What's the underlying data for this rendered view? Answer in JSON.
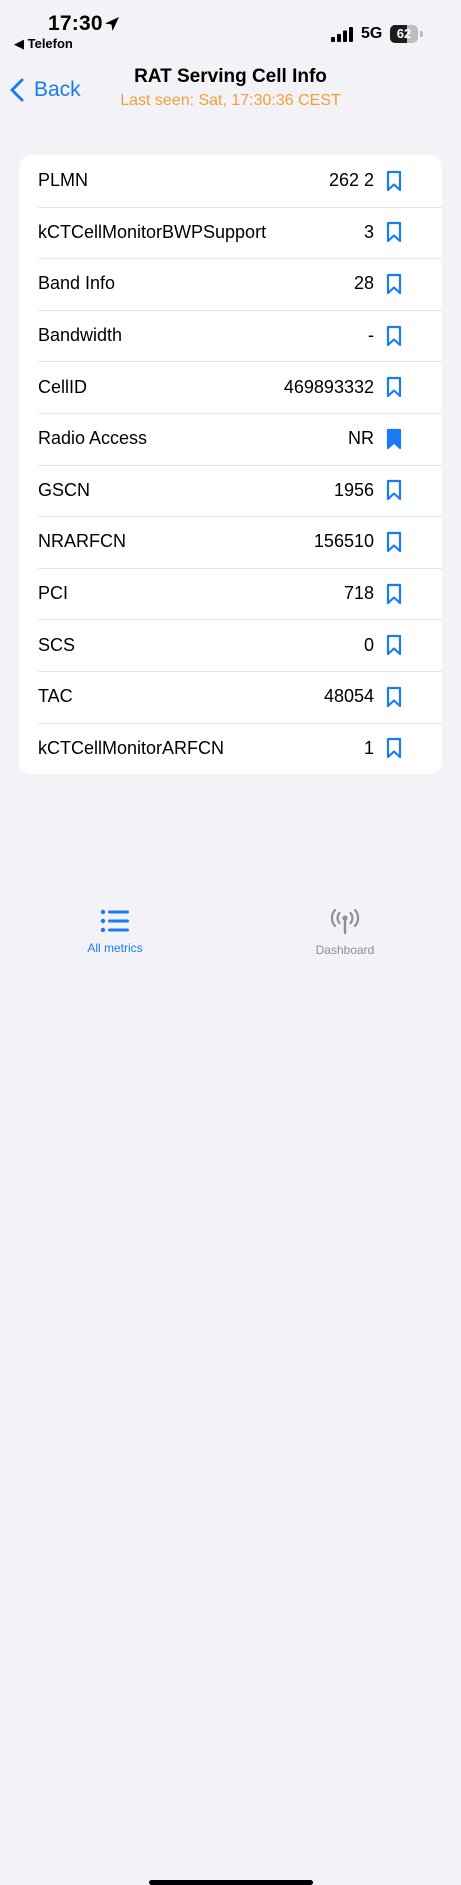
{
  "status_bar": {
    "time": "17:30",
    "back_app": "◀ Telefon",
    "network": "5G",
    "battery": "62",
    "battery_level": 0.62
  },
  "nav": {
    "back_label": "Back",
    "title": "RAT Serving Cell Info",
    "subtitle": "Last seen: Sat, 17:30:36 CEST"
  },
  "rows": [
    {
      "label": "PLMN",
      "value": "262 2",
      "bookmarked": false
    },
    {
      "label": "kCTCellMonitorBWPSupport",
      "value": "3",
      "bookmarked": false
    },
    {
      "label": "Band Info",
      "value": "28",
      "bookmarked": false
    },
    {
      "label": "Bandwidth",
      "value": "-",
      "bookmarked": false
    },
    {
      "label": "CellID",
      "value": "469893332",
      "bookmarked": false
    },
    {
      "label": "Radio Access",
      "value": "NR",
      "bookmarked": true
    },
    {
      "label": "GSCN",
      "value": "1956",
      "bookmarked": false
    },
    {
      "label": "NRARFCN",
      "value": "156510",
      "bookmarked": false
    },
    {
      "label": "PCI",
      "value": "718",
      "bookmarked": false
    },
    {
      "label": "SCS",
      "value": "0",
      "bookmarked": false
    },
    {
      "label": "TAC",
      "value": "48054",
      "bookmarked": false
    },
    {
      "label": "kCTCellMonitorARFCN",
      "value": "1",
      "bookmarked": false
    }
  ],
  "tabs": [
    {
      "label": "All metrics",
      "icon": "list-icon",
      "active": true
    },
    {
      "label": "Dashboard",
      "icon": "antenna-icon",
      "active": false
    }
  ],
  "colors": {
    "accent": "#1A7CF5",
    "subtitle": "#F1A134",
    "inactive": "#8E8E93",
    "background": "#F2F2F7"
  }
}
